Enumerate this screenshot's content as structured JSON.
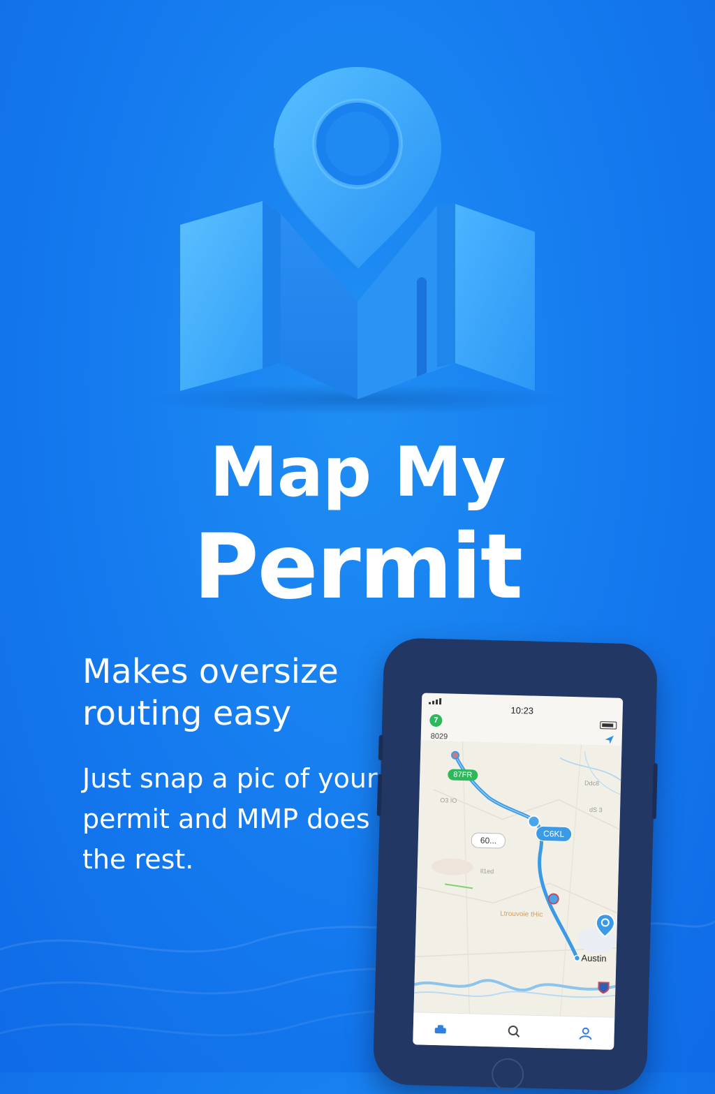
{
  "app": {
    "title_line1": "Map My",
    "title_line2": "Permit",
    "tagline": "Makes oversize routing easy",
    "description": "Just snap a pic of your permit and MMP does the rest."
  },
  "colors": {
    "background": "#1479ee",
    "logo_light": "#4fb8ff",
    "logo_mid": "#2a98f6",
    "logo_dark": "#1a7ee8",
    "phone_body": "#223763",
    "route": "#3b9ae6"
  },
  "phone": {
    "status": {
      "time": "10:23"
    },
    "header": {
      "badge_number": "7",
      "left_code": "8029"
    },
    "map": {
      "labels": {
        "route_badge": "87FR",
        "mid_badge": "C6KL",
        "distance_box": "60...",
        "city": "Austin",
        "faint_left": "O3 IO",
        "faint_right_1": "Ddc8",
        "faint_right_2": "dS 3",
        "faint_mid": "Ltrouvoie tHic",
        "faint_small": "Il1ed"
      },
      "icons": [
        "location-pin-icon",
        "interstate-shield-icon"
      ]
    },
    "tabbar": {
      "icons": [
        "truck-icon",
        "search-icon",
        "profile-icon"
      ]
    }
  }
}
